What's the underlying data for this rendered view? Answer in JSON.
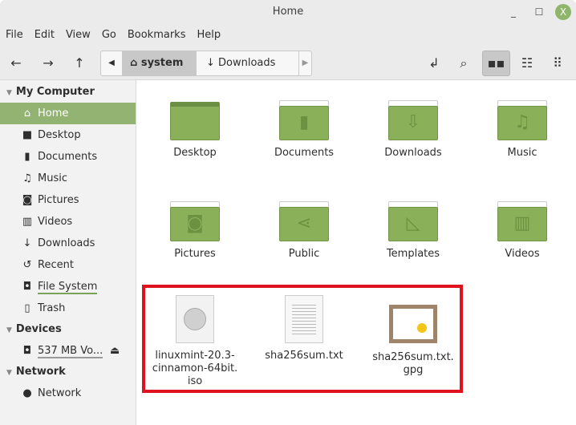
{
  "window": {
    "title": "Home",
    "minimize": "_",
    "maximize": "☐",
    "close": "X"
  },
  "menu": [
    "File",
    "Edit",
    "View",
    "Go",
    "Bookmarks",
    "Help"
  ],
  "path": {
    "current": "system",
    "next": "Downloads"
  },
  "sidebar": {
    "sections": [
      {
        "title": "My Computer",
        "items": [
          {
            "label": "Home",
            "icon": "home-icon"
          },
          {
            "label": "Desktop",
            "icon": "desktop-icon"
          },
          {
            "label": "Documents",
            "icon": "document-icon"
          },
          {
            "label": "Music",
            "icon": "music-icon"
          },
          {
            "label": "Pictures",
            "icon": "camera-icon"
          },
          {
            "label": "Videos",
            "icon": "film-icon"
          },
          {
            "label": "Downloads",
            "icon": "download-icon"
          },
          {
            "label": "Recent",
            "icon": "history-icon"
          },
          {
            "label": "File System",
            "icon": "drive-icon"
          },
          {
            "label": "Trash",
            "icon": "trash-icon"
          }
        ]
      },
      {
        "title": "Devices",
        "items": [
          {
            "label": "537 MB Vo...",
            "icon": "drive-icon"
          }
        ]
      },
      {
        "title": "Network",
        "items": [
          {
            "label": "Network",
            "icon": "globe-icon"
          }
        ]
      }
    ]
  },
  "folders": [
    "Desktop",
    "Documents",
    "Downloads",
    "Music",
    "Pictures",
    "Public",
    "Templates",
    "Videos"
  ],
  "files": [
    {
      "name": "linuxmint-20.3-cinnamon-64bit.iso",
      "lines": [
        "linuxmint-20.3-",
        "cinnamon-64bit.",
        "iso"
      ]
    },
    {
      "name": "sha256sum.txt",
      "lines": [
        "sha256sum.txt"
      ]
    },
    {
      "name": "sha256sum.txt.gpg",
      "lines": [
        "sha256sum.txt.",
        "gpg"
      ]
    }
  ],
  "colors": {
    "accent": "#92b372",
    "folder": "#8ab15a",
    "highlight": "#e0121e"
  }
}
